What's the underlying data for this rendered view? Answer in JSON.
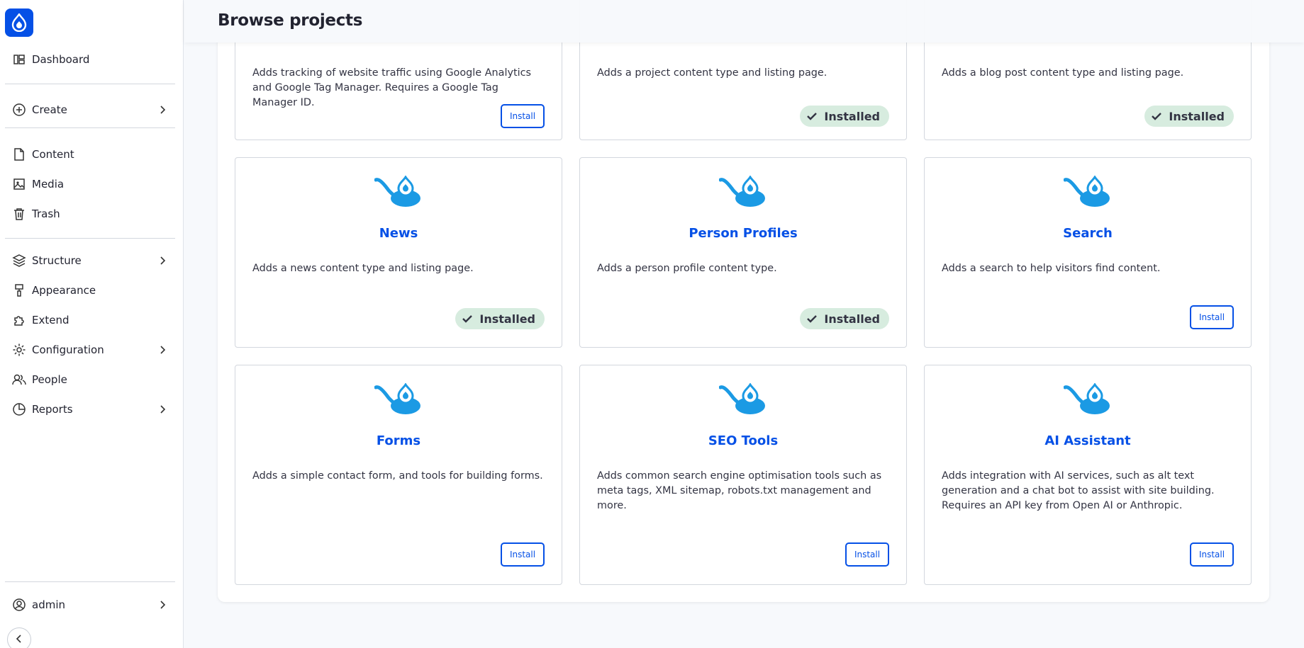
{
  "page": {
    "title": "Browse projects"
  },
  "sidebar": {
    "dashboard": "Dashboard",
    "create": "Create",
    "content": "Content",
    "media": "Media",
    "trash": "Trash",
    "structure": "Structure",
    "appearance": "Appearance",
    "extend": "Extend",
    "configuration": "Configuration",
    "people": "People",
    "reports": "Reports",
    "user": "admin"
  },
  "colors": {
    "accent": "#0550e6",
    "installed_bg": "#d7ecdf",
    "logo_blue": "#1b9ae4"
  },
  "cards": [
    {
      "title": "",
      "description": "Adds tracking of website traffic using Google Analytics and Google Tag Manager. Requires a Google Tag Manager ID.",
      "status": "Install"
    },
    {
      "title": "",
      "description": "Adds a project content type and listing page.",
      "status": "Installed"
    },
    {
      "title": "",
      "description": "Adds a blog post content type and listing page.",
      "status": "Installed"
    },
    {
      "title": "News",
      "description": "Adds a news content type and listing page.",
      "status": "Installed"
    },
    {
      "title": "Person Profiles",
      "description": "Adds a person profile content type.",
      "status": "Installed"
    },
    {
      "title": "Search",
      "description": "Adds a search to help visitors find content.",
      "status": "Install"
    },
    {
      "title": "Forms",
      "description": "Adds a simple contact form, and tools for building forms.",
      "status": "Install"
    },
    {
      "title": "SEO Tools",
      "description": "Adds common search engine optimisation tools such as meta tags, XML sitemap, robots.txt management and more.",
      "status": "Install"
    },
    {
      "title": "AI Assistant",
      "description": "Adds integration with AI services, such as alt text generation and a chat bot to assist with site building. Requires an API key from Open AI or Anthropic.",
      "status": "Install"
    }
  ]
}
